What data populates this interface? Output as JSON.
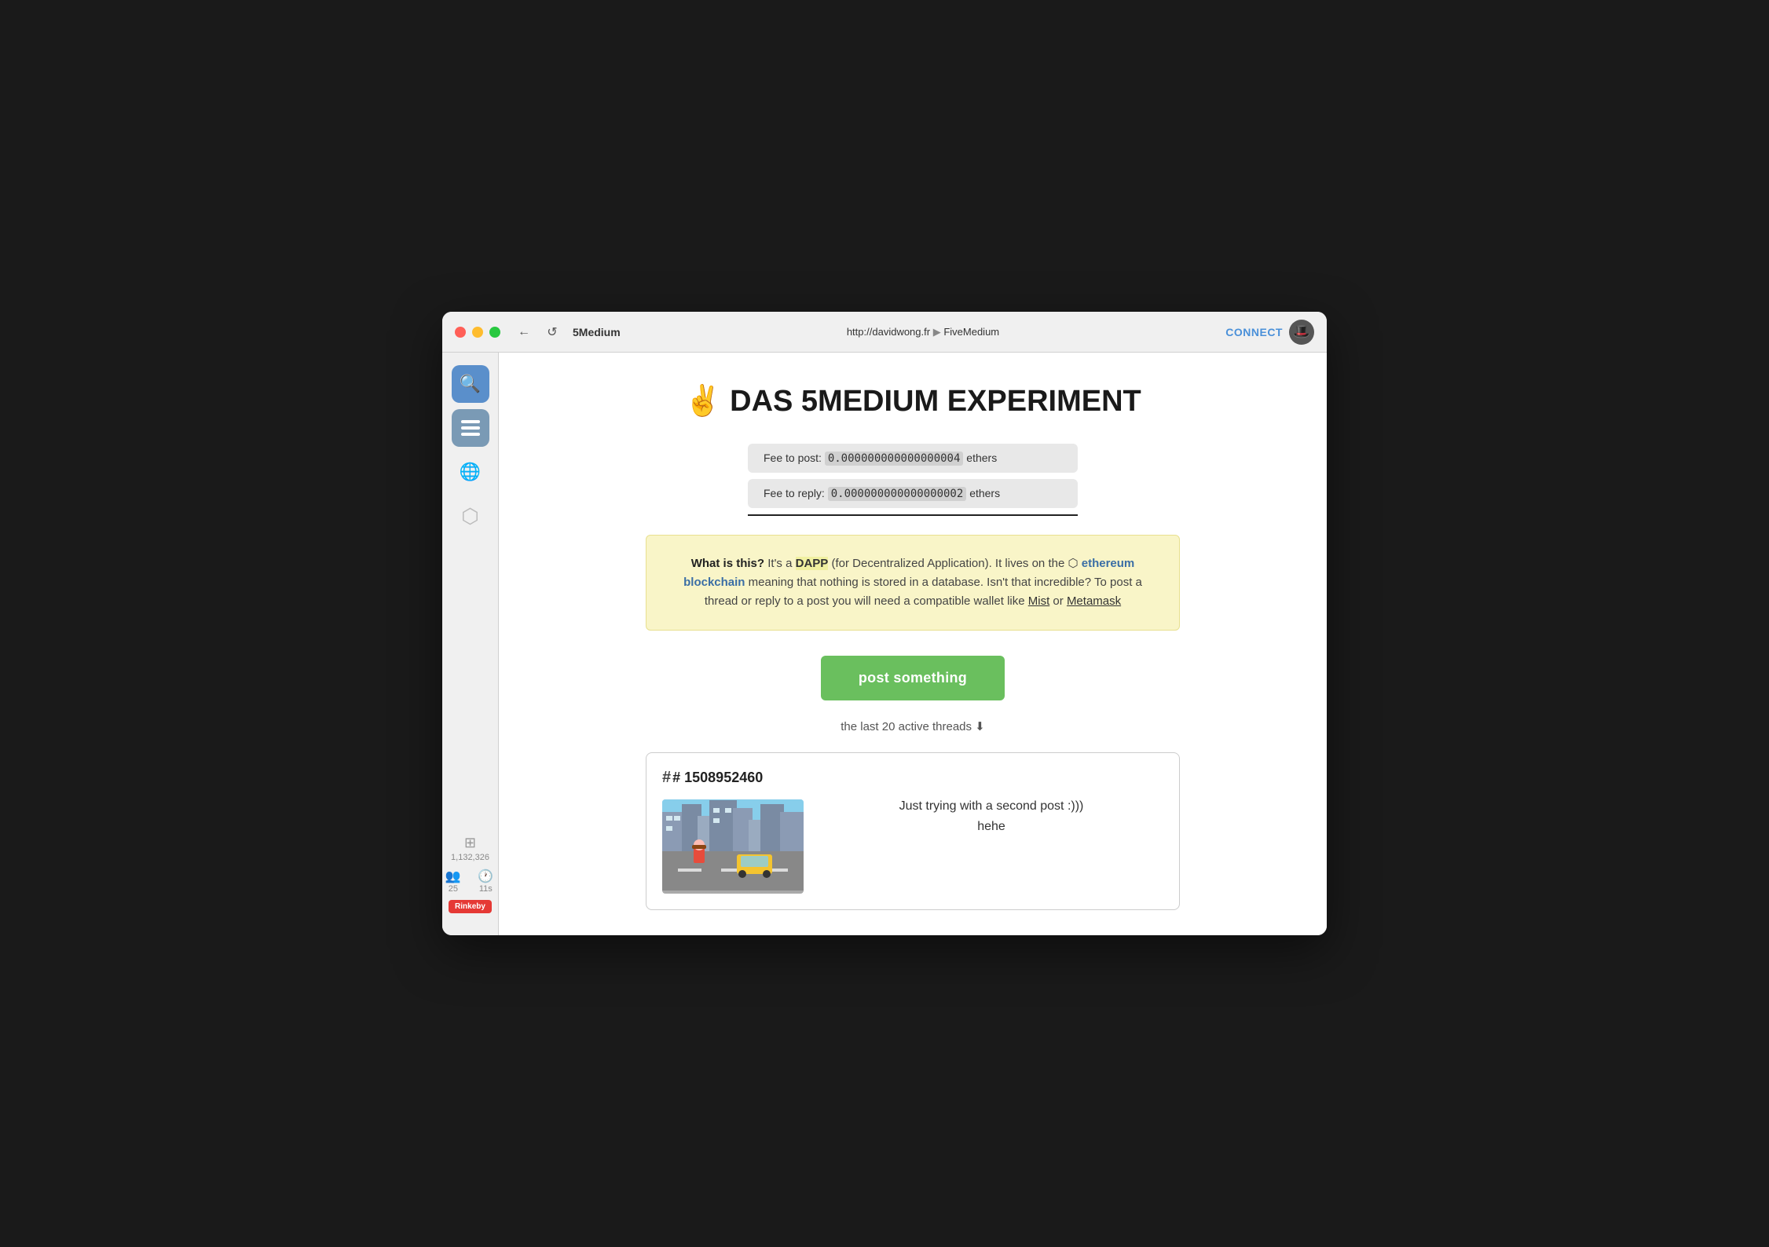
{
  "window": {
    "title": "5Medium"
  },
  "titlebar": {
    "back_icon": "←",
    "refresh_icon": "↺",
    "app_name": "5Medium",
    "url_prefix": "http://",
    "url_domain": "davidwong.fr",
    "url_separator": "▶",
    "url_path": "FiveMedium",
    "connect_label": "CONNECT",
    "avatar_icon": "🎩"
  },
  "sidebar": {
    "search_icon": "🔍",
    "list_icon": "☰",
    "globe_icon": "🌐",
    "ethereum_icon": "⬡",
    "block_count": "1,132,326",
    "peers": "25",
    "sync_time": "11s",
    "network": "Rinkeby"
  },
  "main": {
    "page_title": "✌️ DAS 5MEDIUM EXPERIMENT",
    "fee_post_label": "Fee to post:",
    "fee_post_value": "0.000000000000000004",
    "fee_post_unit": "ethers",
    "fee_reply_label": "Fee to reply:",
    "fee_reply_value": "0.000000000000000002",
    "fee_reply_unit": "ethers",
    "info_what_label": "What is this?",
    "info_text1": "It's a ",
    "info_dapp": "DAPP",
    "info_text2": " (for Decentralized Application). It lives on the ",
    "info_eth": "ethereum blockchain",
    "info_text3": " meaning that nothing is stored in a database. Isn't that incredible? To post a thread or reply to a post you will need a compatible wallet like ",
    "info_mist": "Mist",
    "info_or": " or ",
    "info_metamask": "Metamask",
    "post_button": "post something",
    "last_threads_label": "the last 20 active threads ⬇",
    "thread": {
      "id": "# 1508952460",
      "text1": "Just trying with a second post :)))",
      "text2": "hehe"
    }
  }
}
